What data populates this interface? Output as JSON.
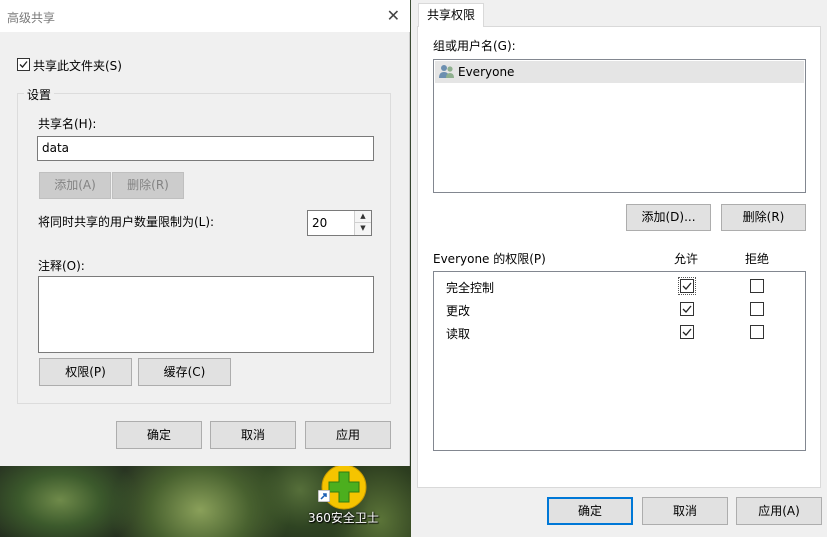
{
  "advanced_sharing": {
    "title": "高级共享",
    "share_folder_label": "共享此文件夹(S)",
    "share_folder_checked": true,
    "settings_group": "设置",
    "share_name_label": "共享名(H):",
    "share_name_value": "data",
    "add_button": "添加(A)",
    "remove_button": "删除(R)",
    "user_limit_label": "将同时共享的用户数量限制为(L):",
    "user_limit_value": "20",
    "comments_label": "注释(O):",
    "comments_value": "",
    "permissions_button": "权限(P)",
    "caching_button": "缓存(C)",
    "ok_button": "确定",
    "cancel_button": "取消",
    "apply_button": "应用"
  },
  "share_permissions": {
    "tab_label": "共享权限",
    "group_label": "组或用户名(G):",
    "users": [
      "Everyone"
    ],
    "add_button": "添加(D)...",
    "remove_button": "删除(R)",
    "permissions_for_label": "Everyone 的权限(P)",
    "allow_header": "允许",
    "deny_header": "拒绝",
    "rows": [
      {
        "name": "完全控制",
        "allow": true,
        "deny": false
      },
      {
        "name": "更改",
        "allow": true,
        "deny": false
      },
      {
        "name": "读取",
        "allow": true,
        "deny": false
      }
    ],
    "ok_button": "确定",
    "cancel_button": "取消",
    "apply_button": "应用(A)"
  },
  "desktop": {
    "icon_label": "360安全卫士",
    "icon_color": "#f5c400",
    "icon_accent": "#4caf1e"
  }
}
